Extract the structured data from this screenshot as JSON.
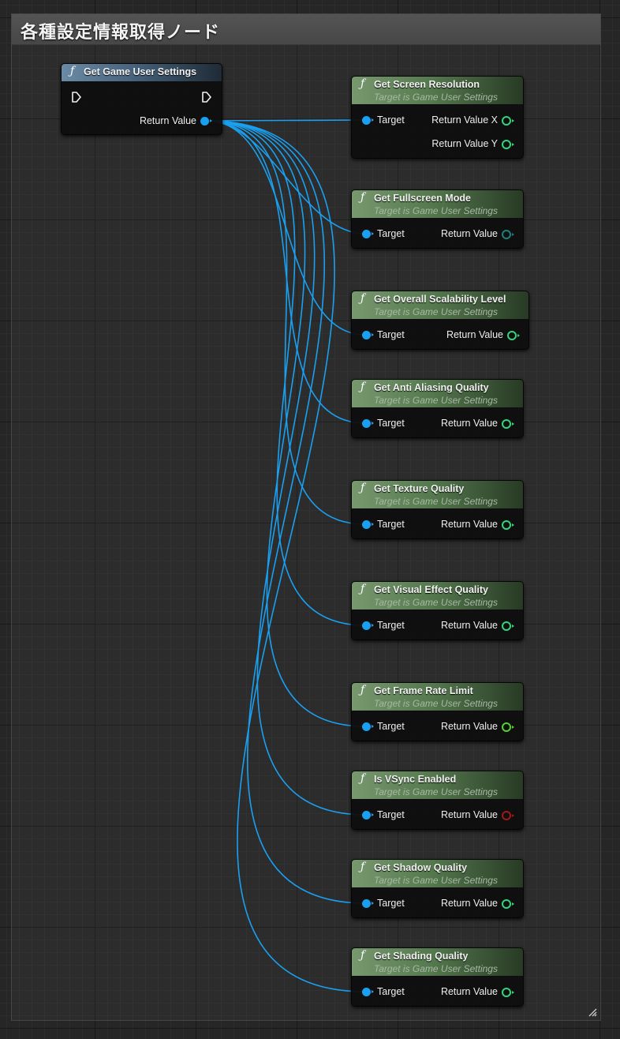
{
  "comment": {
    "title": "各種設定情報取得ノード"
  },
  "source_node": {
    "icon": "function-icon",
    "title": "Get Game User Settings",
    "return_label": "Return Value"
  },
  "nodes": [
    {
      "title": "Get Screen Resolution",
      "subtitle": "Target is Game User Settings",
      "target_label": "Target",
      "outputs": [
        {
          "label": "Return Value X",
          "type": "int",
          "color": "#35d37c"
        },
        {
          "label": "Return Value Y",
          "type": "int",
          "color": "#35d37c"
        }
      ]
    },
    {
      "title": "Get Fullscreen Mode",
      "subtitle": "Target is Game User Settings",
      "target_label": "Target",
      "outputs": [
        {
          "label": "Return Value",
          "type": "byte",
          "color": "#1c7f7a"
        }
      ]
    },
    {
      "title": "Get Overall Scalability Level",
      "subtitle": "Target is Game User Settings",
      "target_label": "Target",
      "outputs": [
        {
          "label": "Return Value",
          "type": "int",
          "color": "#35d37c"
        }
      ]
    },
    {
      "title": "Get Anti Aliasing Quality",
      "subtitle": "Target is Game User Settings",
      "target_label": "Target",
      "outputs": [
        {
          "label": "Return Value",
          "type": "int",
          "color": "#35d37c"
        }
      ]
    },
    {
      "title": "Get Texture Quality",
      "subtitle": "Target is Game User Settings",
      "target_label": "Target",
      "outputs": [
        {
          "label": "Return Value",
          "type": "int",
          "color": "#35d37c"
        }
      ]
    },
    {
      "title": "Get Visual Effect Quality",
      "subtitle": "Target is Game User Settings",
      "target_label": "Target",
      "outputs": [
        {
          "label": "Return Value",
          "type": "int",
          "color": "#35d37c"
        }
      ]
    },
    {
      "title": "Get Frame Rate Limit",
      "subtitle": "Target is Game User Settings",
      "target_label": "Target",
      "outputs": [
        {
          "label": "Return Value",
          "type": "float",
          "color": "#52d42c"
        }
      ]
    },
    {
      "title": "Is VSync Enabled",
      "subtitle": "Target is Game User Settings",
      "target_label": "Target",
      "outputs": [
        {
          "label": "Return Value",
          "type": "bool",
          "color": "#a01818"
        }
      ]
    },
    {
      "title": "Get Shadow Quality",
      "subtitle": "Target is Game User Settings",
      "target_label": "Target",
      "outputs": [
        {
          "label": "Return Value",
          "type": "int",
          "color": "#35d37c"
        }
      ]
    },
    {
      "title": "Get Shading Quality",
      "subtitle": "Target is Game User Settings",
      "target_label": "Target",
      "outputs": [
        {
          "label": "Return Value",
          "type": "int",
          "color": "#35d37c"
        }
      ]
    }
  ],
  "colors": {
    "wire": "#1aa0f0",
    "function_header": "#567a4f",
    "source_header": "#46627c",
    "background": "#262626"
  }
}
